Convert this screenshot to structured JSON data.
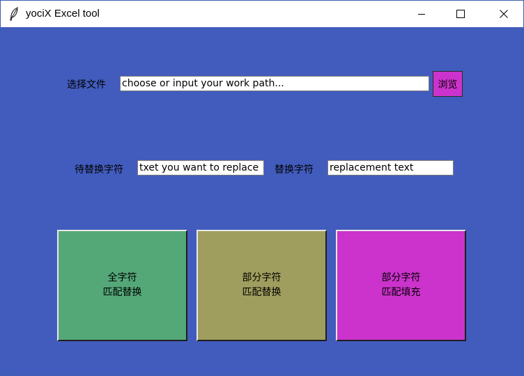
{
  "window": {
    "title": "yociX Excel tool",
    "app_icon": "feather-icon",
    "controls": [
      "minimize-icon",
      "maximize-icon",
      "close-icon"
    ]
  },
  "file_row": {
    "label": "选择文件",
    "path_input_value": "choose or input your work path...",
    "browse_label": "浏览"
  },
  "replace_row": {
    "find_label": "待替换字符",
    "find_input_value": "txet you want to replace",
    "replace_label": "替换字符",
    "replace_input_value": "replacement text"
  },
  "actions": [
    {
      "line1": "全字符",
      "line2": "匹配替换",
      "color": "#54a878"
    },
    {
      "line1": "部分字符",
      "line2": "匹配替换",
      "color": "#a09e5e"
    },
    {
      "line1": "部分字符",
      "line2": "匹配填充",
      "color": "#cc33cc"
    }
  ],
  "colors": {
    "background": "#425cbd",
    "browse_button": "#cc33cc"
  }
}
